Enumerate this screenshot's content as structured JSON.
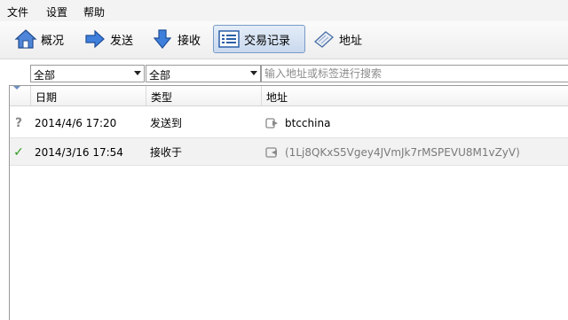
{
  "menu": {
    "file": "文件",
    "settings": "设置",
    "help": "帮助"
  },
  "toolbar": {
    "overview": "概况",
    "send": "发送",
    "receive": "接收",
    "transactions": "交易记录",
    "addresses": "地址"
  },
  "filters": {
    "date_filter": "全部",
    "type_filter": "全部",
    "search_placeholder": "输入地址或标签进行搜索"
  },
  "table": {
    "columns": {
      "date": "日期",
      "type": "类型",
      "address": "地址"
    },
    "rows": [
      {
        "status": "?",
        "status_color": "#8a8a8a",
        "date": "2014/4/6 17:20",
        "type": "发送到",
        "address": "btcchina"
      },
      {
        "status": "✓",
        "status_color": "#2e9a1f",
        "date": "2014/3/16 17:54",
        "type": "接收于",
        "address": "(1Lj8QKxS5Vgey4JVmJk7rMSPEVU8M1vZyV)"
      }
    ]
  },
  "colors": {
    "accent": "#7a9ac6",
    "send_arrow": "#2f6fd1",
    "receive_arrow": "#2f6fd1"
  }
}
